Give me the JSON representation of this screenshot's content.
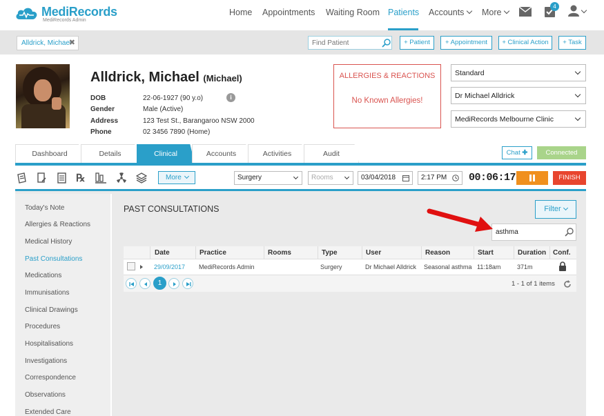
{
  "app": {
    "name": "MediRecords",
    "subtitle": "MediRecords Admin"
  },
  "nav": {
    "home": "Home",
    "appointments": "Appointments",
    "waiting_room": "Waiting Room",
    "patients": "Patients",
    "accounts": "Accounts",
    "more": "More",
    "task_badge": "4"
  },
  "strip": {
    "patient_tab": "Alldrick, Michael",
    "find_placeholder": "Find Patient",
    "btn_patient": "+ Patient",
    "btn_appointment": "+ Appointment",
    "btn_clinical": "+ Clinical Action",
    "btn_task": "+ Task"
  },
  "patient": {
    "name": "Alldrick, Michael",
    "preferred": "(Michael)",
    "labels": [
      "DOB",
      "Gender",
      "Address",
      "Phone"
    ],
    "dob": "22-06-1927 (90 y.o)",
    "gender": "Male (Active)",
    "address": "123 Test St., Barangaroo NSW 2000",
    "phone": "02 3456 7890 (Home)"
  },
  "allergies": {
    "title": "ALLERGIES & REACTIONS",
    "value": "No Known Allergies!"
  },
  "selects": {
    "type": "Standard",
    "doctor": "Dr Michael Alldrick",
    "clinic": "MediRecords Melbourne Clinic"
  },
  "tabs": [
    "Dashboard",
    "Details",
    "Clinical",
    "Accounts",
    "Activities",
    "Audit"
  ],
  "chat_label": "Chat",
  "connected_label": "Connected",
  "toolbar": {
    "more": "More",
    "location": "Surgery",
    "rooms": "Rooms",
    "date": "03/04/2018",
    "time": "2:17 PM",
    "timer": "00:06:17",
    "finish": "FINISH"
  },
  "sidenav": [
    "Today's Note",
    "Allergies & Reactions",
    "Medical History",
    "Past Consultations",
    "Medications",
    "Immunisations",
    "Clinical Drawings",
    "Procedures",
    "Hospitalisations",
    "Investigations",
    "Correspondence",
    "Observations",
    "Extended Care"
  ],
  "consultations": {
    "title": "PAST CONSULTATIONS",
    "filter": "Filter",
    "search_value": "asthma",
    "columns": [
      "Date",
      "Practice",
      "Rooms",
      "Type",
      "User",
      "Reason",
      "Start",
      "Duration",
      "Conf."
    ],
    "rows": [
      {
        "date": "29/09/2017",
        "practice": "MediRecords Admin",
        "rooms": "",
        "type": "Surgery",
        "user": "Dr Michael Alldrick",
        "reason": "Seasonal asthma",
        "start": "11:18am",
        "duration": "371m"
      }
    ],
    "current_page": "1",
    "items_text": "1 - 1 of 1 items"
  },
  "colors": {
    "accent": "#2a9fc9",
    "danger": "#d9534f",
    "pause": "#f0901e",
    "finish": "#e8452e",
    "connected": "#a9d48a"
  }
}
